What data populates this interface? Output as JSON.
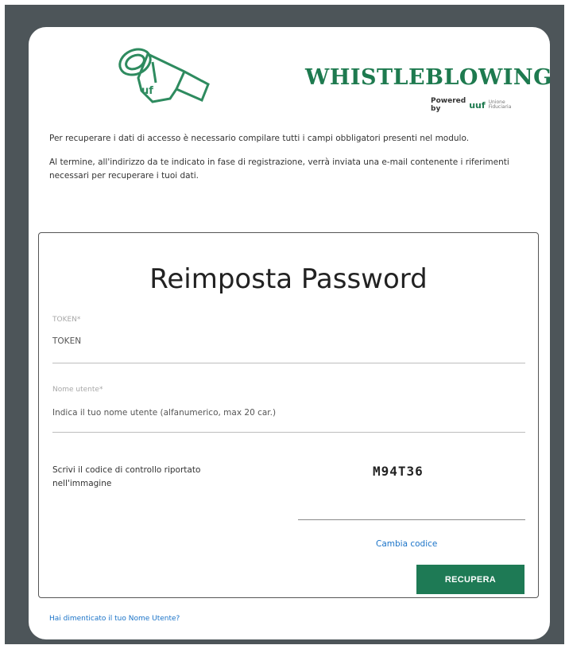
{
  "header": {
    "brand_name": "WHISTLEBLOWING",
    "powered_by": "Powered by",
    "powered_mark": "uuf",
    "powered_small": "Unione Fiduciaria",
    "logo_icon": "whistle-icon",
    "logo_text": "uf",
    "brand_color": "#1e7a4f"
  },
  "intro": {
    "paragraph1": "Per recuperare i dati di accesso è necessario compilare tutti i campi obbligatori presenti nel modulo.",
    "paragraph2": "Al termine, all'indirizzo da te indicato in fase di registrazione, verrà inviata una e-mail contenente i riferimenti necessari per recuperare i tuoi dati."
  },
  "form": {
    "title": "Reimposta Password",
    "token": {
      "label": "TOKEN*",
      "value": "TOKEN"
    },
    "username": {
      "label": "Nome utente*",
      "placeholder": "Indica il tuo nome utente (alfanumerico, max 20 car.)"
    },
    "captcha": {
      "label": "Scrivi il codice di controllo riportato nell'immagine",
      "code": "M94T36",
      "change_label": "Cambia codice"
    },
    "submit_label": "RECUPERA",
    "submit_color": "#1e7a55"
  },
  "footer": {
    "forgot_username": "Hai dimenticato il tuo Nome Utente?"
  }
}
